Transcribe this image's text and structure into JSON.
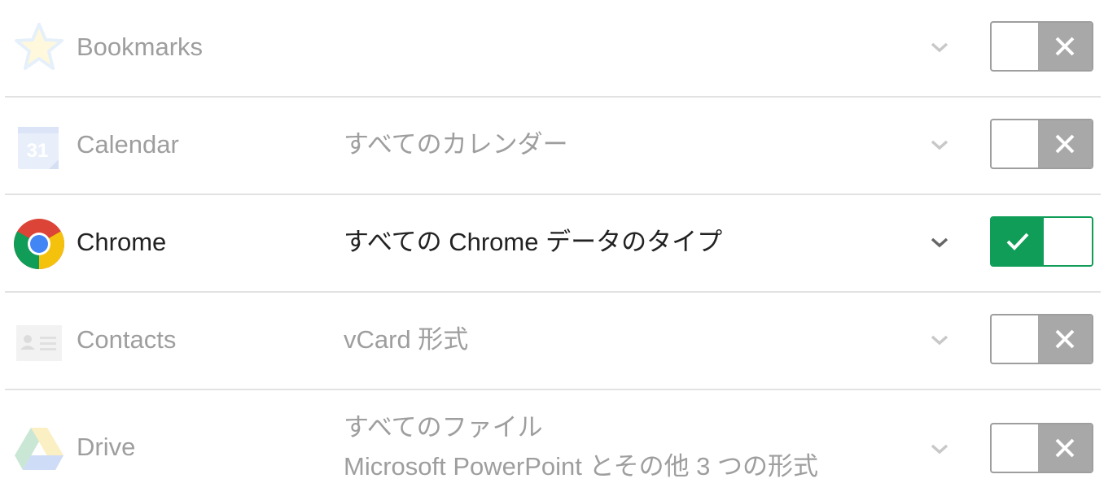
{
  "rows": [
    {
      "name": "Bookmarks",
      "description": "",
      "enabled": false,
      "icon": "star-icon"
    },
    {
      "name": "Calendar",
      "description": "すべてのカレンダー",
      "enabled": false,
      "icon": "calendar-icon",
      "icon_text": "31"
    },
    {
      "name": "Chrome",
      "description": "すべての Chrome データのタイプ",
      "enabled": true,
      "icon": "chrome-icon"
    },
    {
      "name": "Contacts",
      "description": "vCard 形式",
      "enabled": false,
      "icon": "contacts-icon"
    },
    {
      "name": "Drive",
      "description_lines": [
        "すべてのファイル",
        "Microsoft PowerPoint とその他 3 つの形式"
      ],
      "enabled": false,
      "icon": "drive-icon"
    }
  ],
  "colors": {
    "active_green": "#0f9d58",
    "disabled_grey": "#a8a8a8",
    "text_dim": "#9e9e9e",
    "text_active": "#222222",
    "divider": "#e2e2e2"
  }
}
